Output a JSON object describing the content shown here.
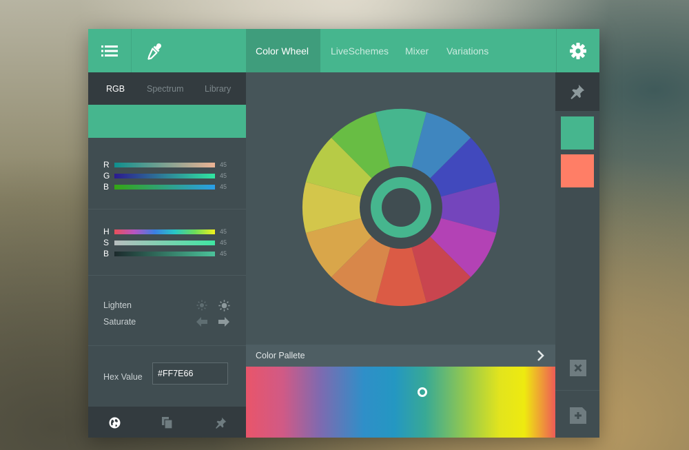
{
  "toolbar": {
    "menu_icon": "list-icon",
    "dropper_icon": "eyedropper-icon",
    "gear_icon": "gear-icon",
    "tabs": [
      {
        "label": "Color Wheel",
        "active": true
      },
      {
        "label": "LiveSchemes",
        "active": false
      },
      {
        "label": "Mixer",
        "active": false
      },
      {
        "label": "Variations",
        "active": false
      }
    ]
  },
  "left": {
    "subtabs": [
      {
        "label": "RGB",
        "active": true
      },
      {
        "label": "Spectrum",
        "active": false
      },
      {
        "label": "Library",
        "active": false
      }
    ],
    "current_color": "#46B68E",
    "rgb": [
      {
        "label": "R",
        "value": "45"
      },
      {
        "label": "G",
        "value": "45"
      },
      {
        "label": "B",
        "value": "45"
      }
    ],
    "hsb": [
      {
        "label": "H",
        "value": "45"
      },
      {
        "label": "S",
        "value": "45"
      },
      {
        "label": "B",
        "value": "45"
      }
    ],
    "lighten_label": "Lighten",
    "saturate_label": "Saturate",
    "hex_label": "Hex Value",
    "hex_value": "#FF7E66",
    "footer_icons": [
      "globe-icon",
      "copy-icon",
      "pin-icon"
    ]
  },
  "wheel": {
    "segment_colors": [
      "#46b68e",
      "#3f86bf",
      "#4149bd",
      "#7445bc",
      "#b342b5",
      "#c9454f",
      "#db5b45",
      "#d8874a",
      "#d9a64a",
      "#d3c64b",
      "#b7cb46",
      "#68bd44"
    ],
    "ring_color": "#46b68e",
    "hub_color": "#404d51"
  },
  "palette": {
    "title": "Color Pallete",
    "chevron_icon": "chevron-right-icon",
    "knob_position": 0.57
  },
  "right": {
    "pin_icon": "pin-icon",
    "swatches": [
      "#46b68e",
      "#ff7e66"
    ],
    "delete_icon": "delete-icon",
    "add_icon": "add-swatch-icon"
  },
  "colors": {
    "accent": "#46b68e",
    "accent_dark": "#3f9d7c",
    "panel": "#404d51",
    "panel_dark": "#333b3f",
    "canvas": "#465559"
  }
}
